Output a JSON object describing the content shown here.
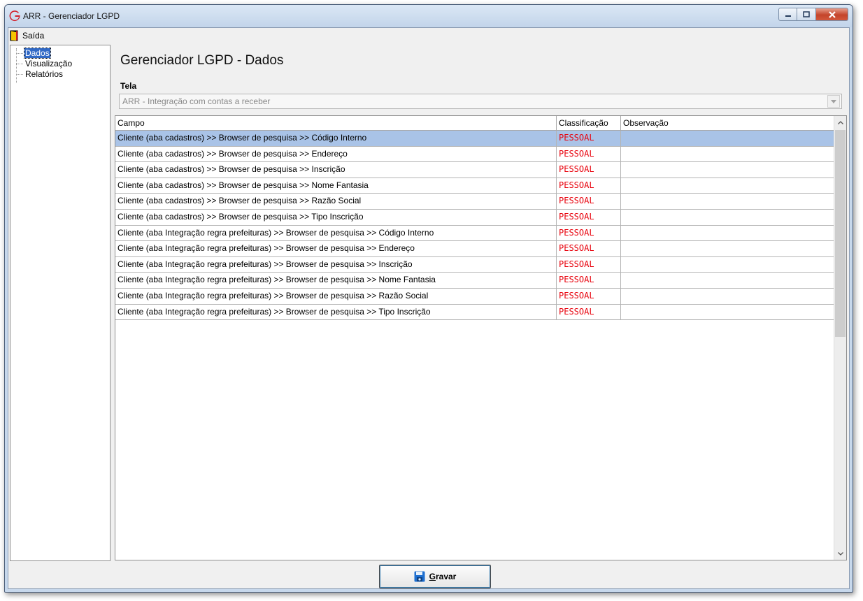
{
  "window": {
    "title": "ARR - Gerenciador LGPD",
    "icon": "app-logo-icon",
    "controls": [
      "minimize-icon",
      "maximize-icon",
      "close-icon"
    ]
  },
  "menu": {
    "items": [
      {
        "label": "Saída",
        "icon": "exit-door-icon"
      }
    ]
  },
  "sidebar": {
    "items": [
      {
        "label": "Dados",
        "selected": true
      },
      {
        "label": "Visualização",
        "selected": false
      },
      {
        "label": "Relatórios",
        "selected": false
      }
    ]
  },
  "main": {
    "title": "Gerenciador LGPD - Dados",
    "tela": {
      "label": "Tela",
      "value": "ARR - Integração com contas a receber"
    },
    "grid": {
      "columns": [
        "Campo",
        "Classificação",
        "Observação"
      ],
      "rows": [
        {
          "campo": "Cliente (aba cadastros) >> Browser de pesquisa >> Código Interno",
          "classificacao": "PESSOAL",
          "observacao": ""
        },
        {
          "campo": "Cliente (aba cadastros) >> Browser de pesquisa >> Endereço",
          "classificacao": "PESSOAL",
          "observacao": ""
        },
        {
          "campo": "Cliente (aba cadastros) >> Browser de pesquisa >> Inscrição",
          "classificacao": "PESSOAL",
          "observacao": ""
        },
        {
          "campo": "Cliente (aba cadastros) >> Browser de pesquisa >> Nome Fantasia",
          "classificacao": "PESSOAL",
          "observacao": ""
        },
        {
          "campo": "Cliente (aba cadastros) >> Browser de pesquisa >> Razão Social",
          "classificacao": "PESSOAL",
          "observacao": ""
        },
        {
          "campo": "Cliente (aba cadastros) >> Browser de pesquisa >> Tipo Inscrição",
          "classificacao": "PESSOAL",
          "observacao": ""
        },
        {
          "campo": "Cliente (aba Integração regra prefeituras) >> Browser de pesquisa >> Código Interno",
          "classificacao": "PESSOAL",
          "observacao": ""
        },
        {
          "campo": "Cliente (aba Integração regra prefeituras) >> Browser de pesquisa >> Endereço",
          "classificacao": "PESSOAL",
          "observacao": ""
        },
        {
          "campo": "Cliente (aba Integração regra prefeituras) >> Browser de pesquisa >> Inscrição",
          "classificacao": "PESSOAL",
          "observacao": ""
        },
        {
          "campo": "Cliente (aba Integração regra prefeituras) >> Browser de pesquisa >> Nome Fantasia",
          "classificacao": "PESSOAL",
          "observacao": ""
        },
        {
          "campo": "Cliente (aba Integração regra prefeituras) >> Browser de pesquisa >> Razão Social",
          "classificacao": "PESSOAL",
          "observacao": ""
        },
        {
          "campo": "Cliente (aba Integração regra prefeituras) >> Browser de pesquisa >> Tipo Inscrição",
          "classificacao": "PESSOAL",
          "observacao": ""
        }
      ],
      "selected_row": 0
    }
  },
  "footer": {
    "save_button": {
      "label_underlined": "G",
      "label_rest": "ravar",
      "icon": "save-disk-icon"
    }
  },
  "colors": {
    "classification_text": "#e8000b",
    "selection": "#a9c3e7",
    "tree_selection": "#3169c6"
  }
}
